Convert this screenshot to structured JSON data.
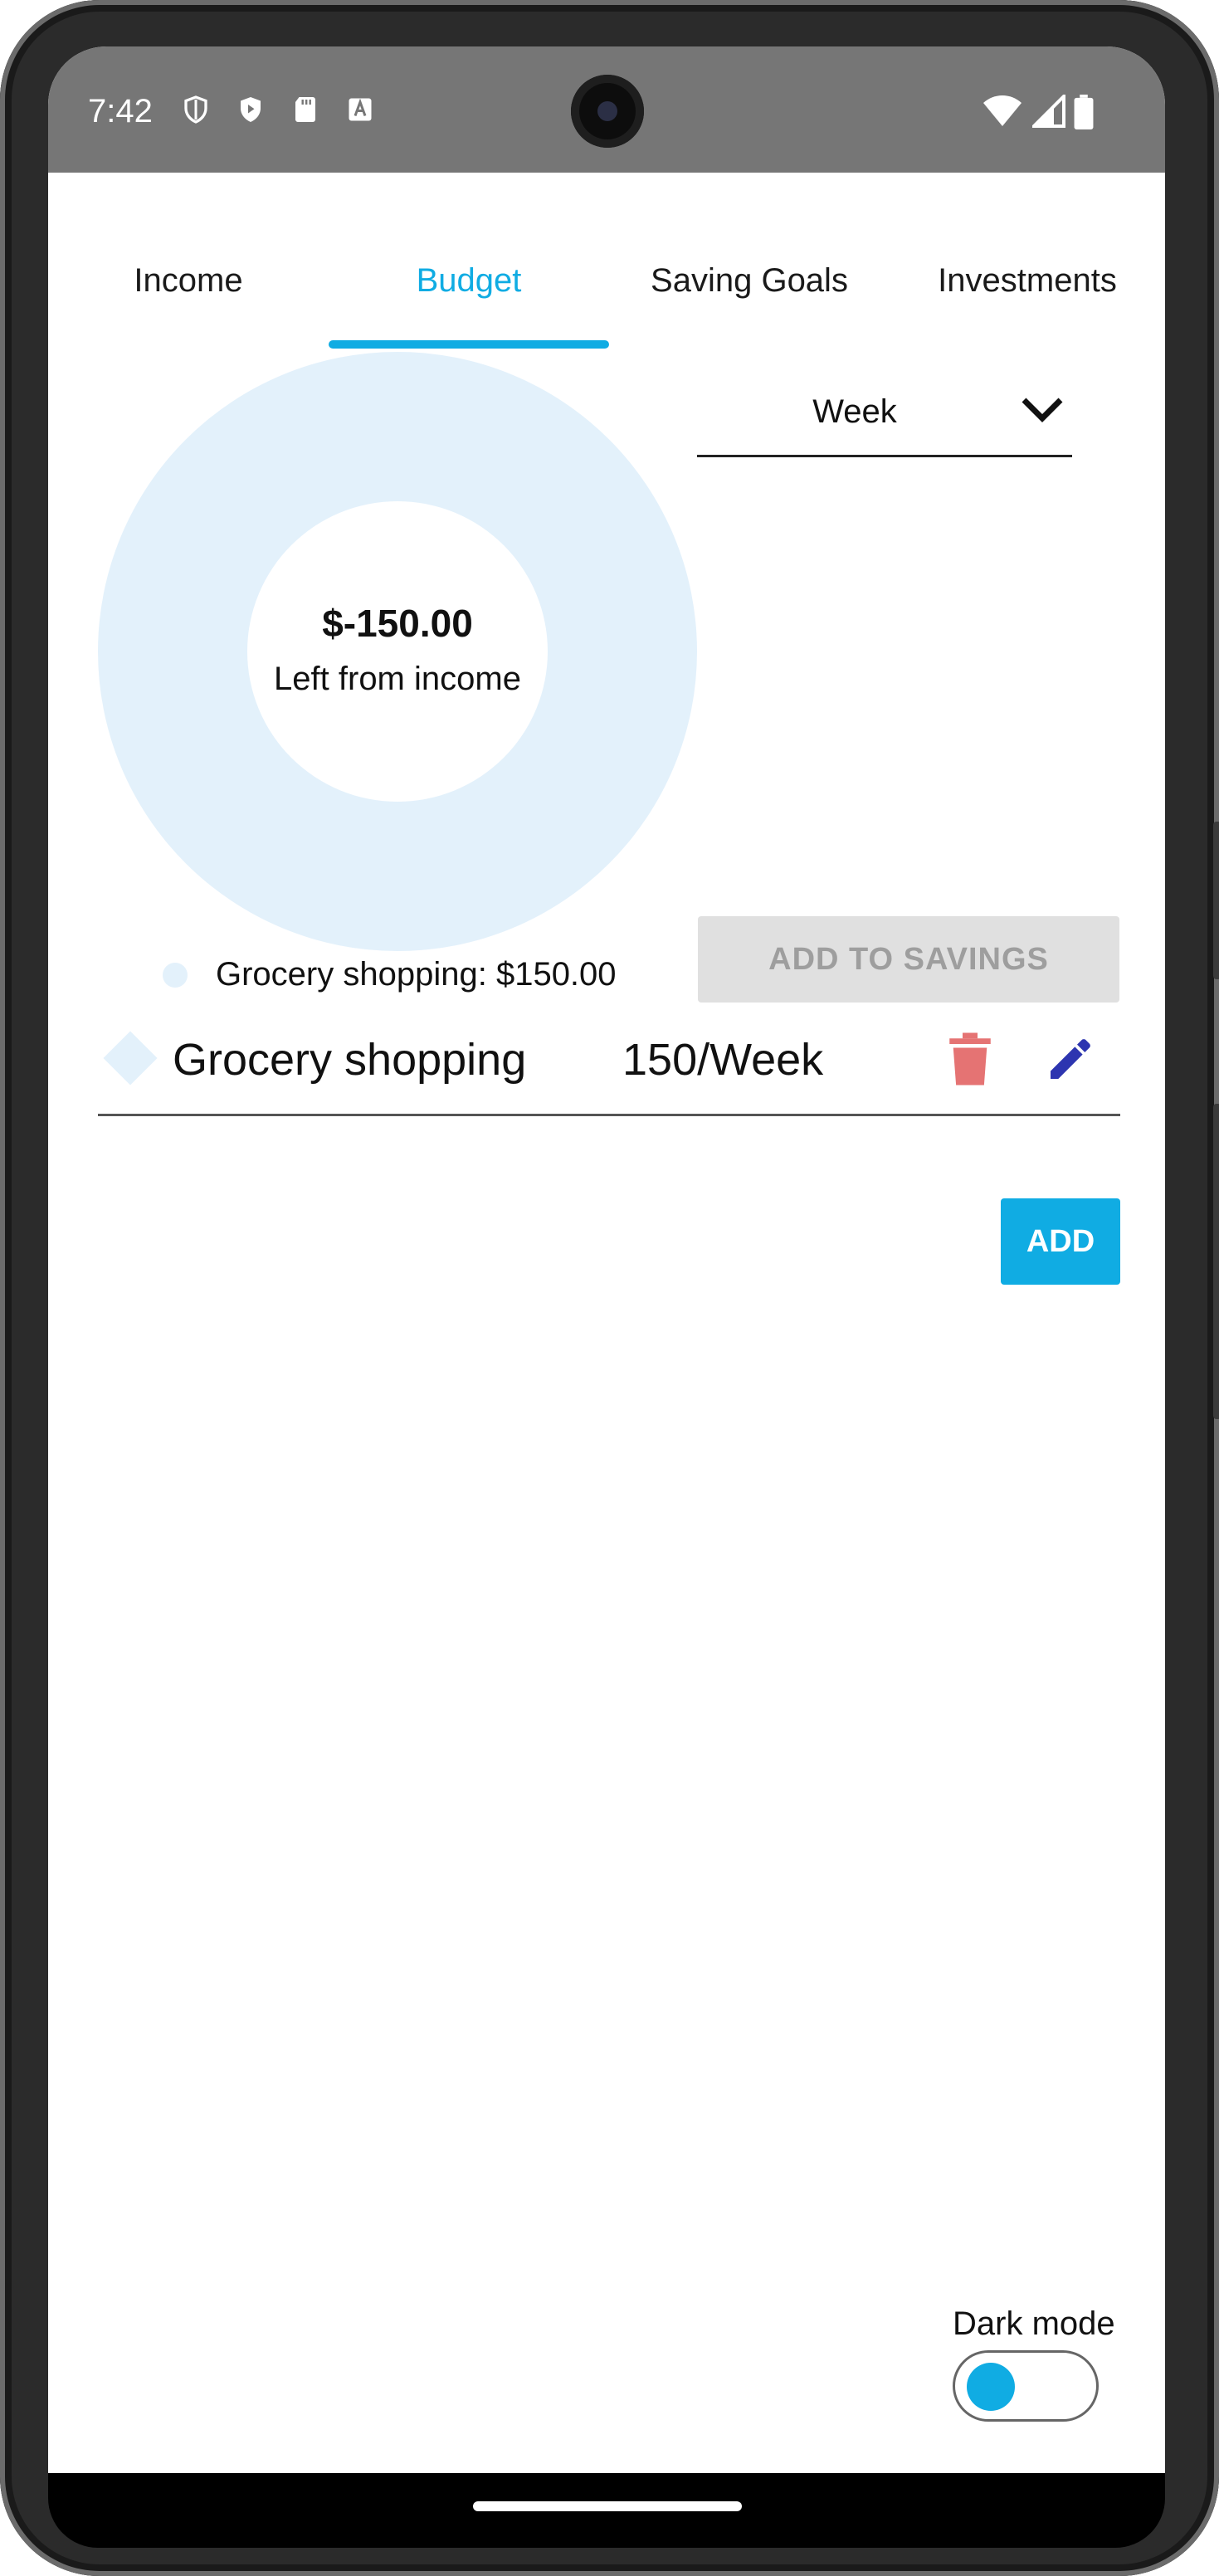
{
  "status_bar": {
    "time": "7:42",
    "left_icons": [
      "shield-outline-icon",
      "play-shield-icon",
      "sd-card-icon",
      "text-a-icon"
    ],
    "right_icons": [
      "wifi-icon",
      "cell-signal-icon",
      "battery-icon"
    ]
  },
  "tabs": [
    {
      "label": "Income",
      "active": false
    },
    {
      "label": "Budget",
      "active": true
    },
    {
      "label": "Saving Goals",
      "active": false
    },
    {
      "label": "Investments",
      "active": false
    }
  ],
  "summary": {
    "amount": "$-150.00",
    "caption": "Left from income",
    "legend": "Grocery shopping: $150.00"
  },
  "chart_data": {
    "type": "pie",
    "categories": [
      "Grocery shopping"
    ],
    "values": [
      150
    ],
    "colors": [
      "#e3f1fb"
    ]
  },
  "period_select": {
    "value": "Week"
  },
  "add_to_savings_label": "ADD TO SAVINGS",
  "budget_items": [
    {
      "name": "Grocery shopping",
      "amount": "150/Week"
    }
  ],
  "add_label": "ADD",
  "dark_mode": {
    "label": "Dark mode",
    "enabled": false
  },
  "colors": {
    "accent": "#10ace3",
    "chart_slice": "#e3f1fb",
    "delete": "#e57373",
    "edit": "#2d35b0"
  }
}
